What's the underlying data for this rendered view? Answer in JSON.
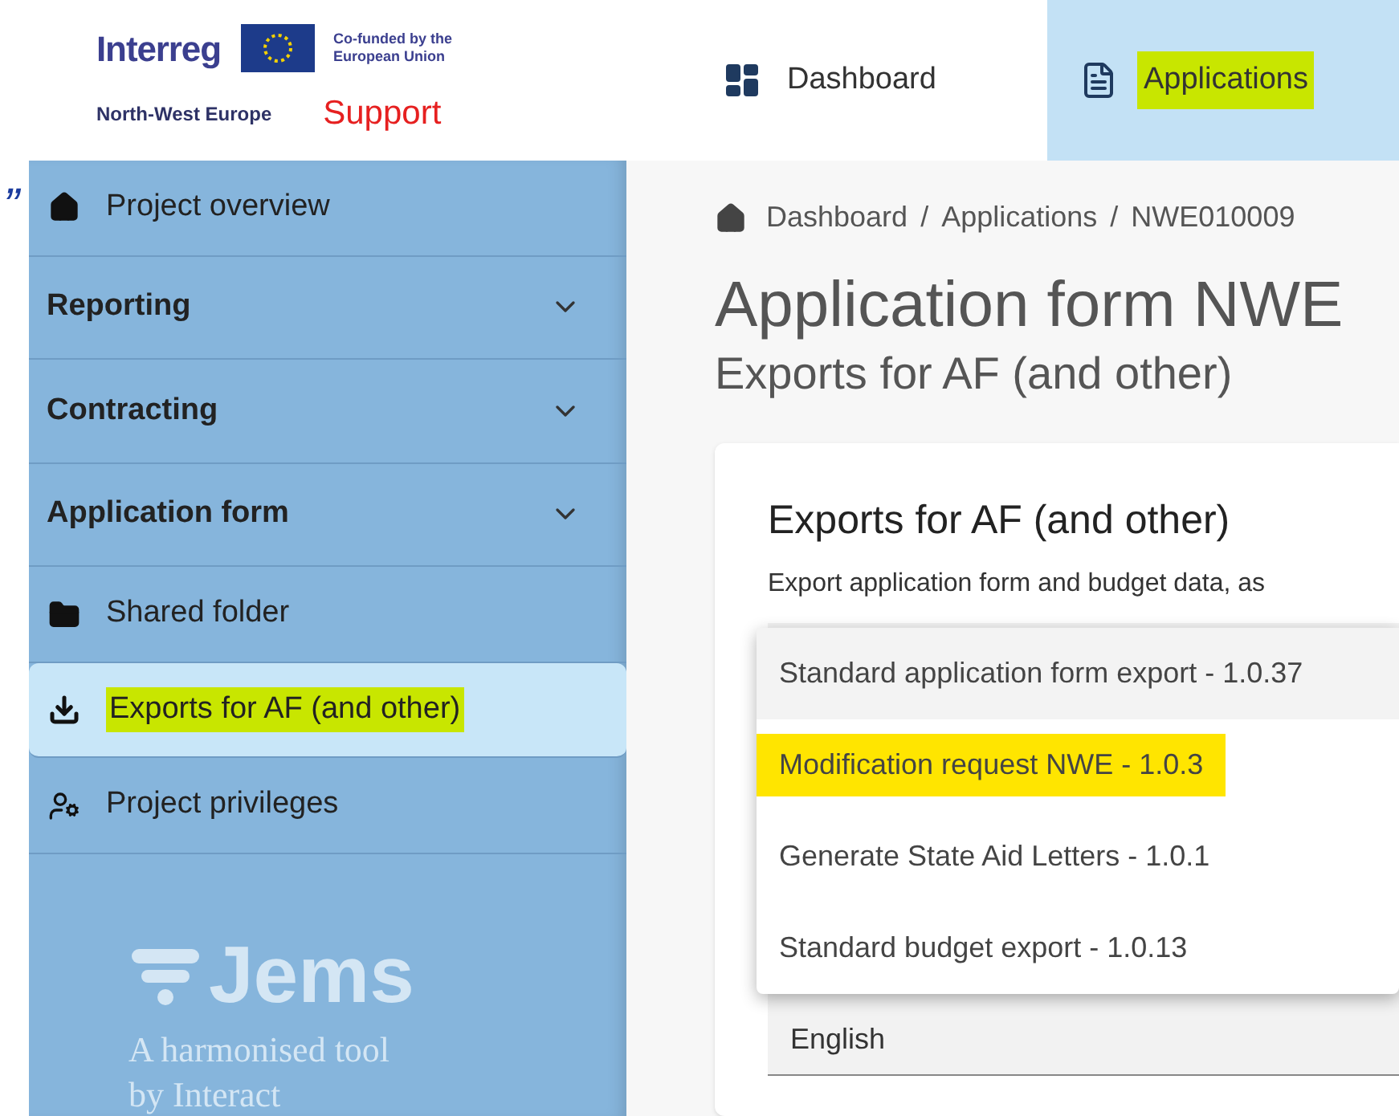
{
  "annotation_mark": "”",
  "logo": {
    "brand": "Interreg",
    "region": "North-West Europe",
    "cofunded": "Co-funded by the European Union",
    "support": "Support"
  },
  "nav_tabs": [
    {
      "label": "Dashboard",
      "selected": false,
      "highlighted": false
    },
    {
      "label": "Applications",
      "selected": true,
      "highlighted": true
    }
  ],
  "sidebar": {
    "items": [
      {
        "kind": "link",
        "label": "Project overview",
        "selected": false,
        "highlighted": false
      },
      {
        "kind": "group",
        "label": "Reporting",
        "expanded": false
      },
      {
        "kind": "group",
        "label": "Contracting",
        "expanded": false
      },
      {
        "kind": "group",
        "label": "Application form",
        "expanded": false
      },
      {
        "kind": "link",
        "label": "Shared folder",
        "selected": false,
        "highlighted": false
      },
      {
        "kind": "link",
        "label": "Exports for AF (and other)",
        "selected": true,
        "highlighted": true
      },
      {
        "kind": "link",
        "label": "Project privileges",
        "selected": false,
        "highlighted": false
      }
    ],
    "footer": {
      "name": "Jems",
      "tagline": "A harmonised tool",
      "by": "by Interact"
    }
  },
  "breadcrumb": {
    "items": [
      "Dashboard",
      "Applications",
      "NWE010009"
    ],
    "separators": [
      "/",
      "/"
    ]
  },
  "page_title": "Application form NWE",
  "page_subtitle": "Exports for AF (and other)",
  "card": {
    "title": "Exports for AF (and other)",
    "description": "Export application form and budget data, as",
    "dropdown_options": [
      {
        "label": "Standard application form export - 1.0.37",
        "selected": true,
        "highlighted": false
      },
      {
        "label": "Modification request NWE - 1.0.3",
        "selected": false,
        "highlighted": true
      },
      {
        "label": "Generate State Aid Letters - 1.0.1",
        "selected": false,
        "highlighted": false
      },
      {
        "label": "Standard budget export - 1.0.13",
        "selected": false,
        "highlighted": false
      }
    ],
    "language_field": {
      "value": "English"
    }
  }
}
